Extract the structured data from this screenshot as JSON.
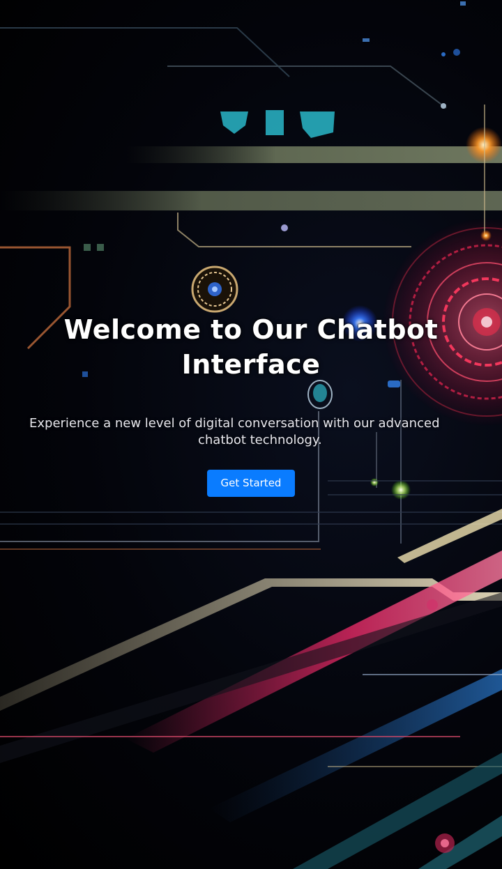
{
  "hero": {
    "title": "Welcome to Our Chatbot Interface",
    "subtitle_line1": "Experience a new level of digital conversation with our advanced",
    "subtitle_line2": "chatbot technology.",
    "cta_label": "Get Started"
  },
  "colors": {
    "cta_background": "#0a7cff",
    "text": "#ffffff",
    "accent_red": "#e0244f",
    "accent_gold": "#e8d9a8",
    "accent_cyan": "#2ab7c9"
  },
  "icons": {
    "emblem": "robot-emblem-icon",
    "radar": "radar-circle-icon"
  }
}
